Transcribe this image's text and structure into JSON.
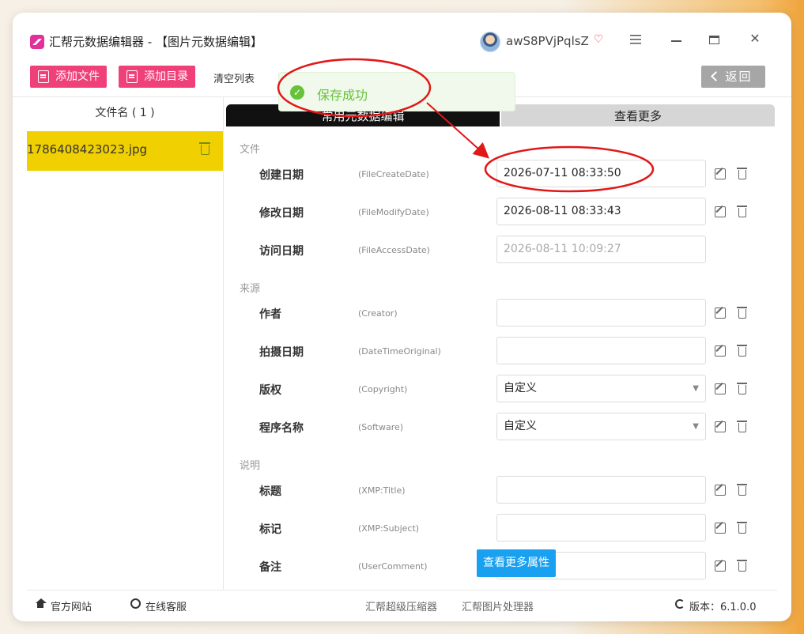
{
  "app": {
    "title": "汇帮元数据编辑器 - 【图片元数据编辑】",
    "username": "awS8PVjPqlsZ"
  },
  "toolbar": {
    "add_file": "添加文件",
    "add_dir": "添加目录",
    "clear_list": "清空列表",
    "back": "返回"
  },
  "files": {
    "header": "文件名 ( 1 )",
    "items": [
      {
        "name": "1786408423023.jpg"
      }
    ]
  },
  "tabs": {
    "active": "常用元数据编辑",
    "more": "查看更多"
  },
  "sections": {
    "file": "文件",
    "source": "来源",
    "desc": "说明"
  },
  "fields": [
    {
      "label": "创建日期",
      "tag": "(FileCreateDate)",
      "value": "2026-07-11 08:33:50"
    },
    {
      "label": "修改日期",
      "tag": "(FileModifyDate)",
      "value": "2026-08-11 08:33:43"
    },
    {
      "label": "访问日期",
      "tag": "(FileAccessDate)",
      "value": "2026-08-11 10:09:27"
    },
    {
      "label": "作者",
      "tag": "(Creator)",
      "value": ""
    },
    {
      "label": "拍摄日期",
      "tag": "(DateTimeOriginal)",
      "value": ""
    },
    {
      "label": "版权",
      "tag": "(Copyright)",
      "value": "自定义"
    },
    {
      "label": "程序名称",
      "tag": "(Software)",
      "value": "自定义"
    },
    {
      "label": "标题",
      "tag": "(XMP:Title)",
      "value": ""
    },
    {
      "label": "标记",
      "tag": "(XMP:Subject)",
      "value": ""
    },
    {
      "label": "备注",
      "tag": "(UserComment)",
      "value": ""
    }
  ],
  "more_props": "查看更多属性",
  "toast": {
    "message": "保存成功"
  },
  "footer": {
    "website": "官方网站",
    "service": "在线客服",
    "compressor": "汇帮超级压缩器",
    "image_tool": "汇帮图片处理器",
    "version": "版本：6.1.0.0"
  },
  "colors": {
    "pink": "#f0407a",
    "file_highlight": "#f0d000",
    "success": "#67c23a",
    "blue_button": "#1aa0f0",
    "annotation": "#e01818"
  }
}
